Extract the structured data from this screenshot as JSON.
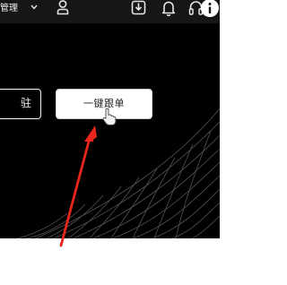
{
  "topbar": {
    "manage_menu_label": "管理",
    "icons": [
      "chevron-down-icon",
      "user-icon",
      "download-icon",
      "bell-icon",
      "headset-icon",
      "info-icon"
    ]
  },
  "hero": {
    "left_button_label": "驻",
    "primary_button_label": "一键跟单"
  },
  "colors": {
    "topbar_bg": "#161616",
    "hero_bg": "#000000",
    "annotation_arrow": "#e8261c",
    "button_bg": "#ffffff"
  }
}
